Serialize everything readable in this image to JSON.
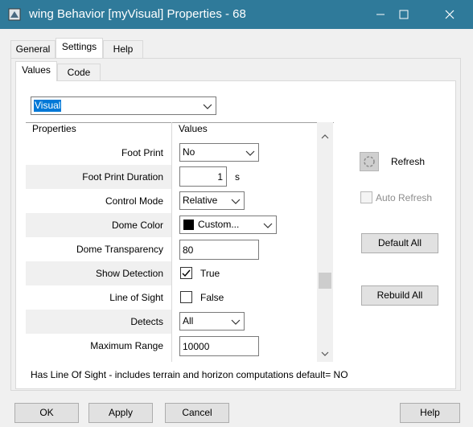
{
  "window": {
    "title": "wing Behavior [myVisual] Properties - 68",
    "controls": {
      "minimize": "minimize",
      "maximize": "maximize",
      "close": "close"
    }
  },
  "main_tabs": [
    {
      "label": "General",
      "active": false
    },
    {
      "label": "Settings",
      "active": true
    },
    {
      "label": "Help",
      "active": false
    }
  ],
  "sub_tabs": [
    {
      "label": "Values",
      "active": true
    },
    {
      "label": "Code",
      "active": false
    }
  ],
  "category_select": {
    "value": "Visual"
  },
  "grid": {
    "headers": {
      "properties": "Properties",
      "values": "Values"
    },
    "rows": [
      {
        "label": "Foot Print",
        "type": "dropdown",
        "value": "No"
      },
      {
        "label": "Foot Print Duration",
        "type": "number",
        "value": "1",
        "unit": "s"
      },
      {
        "label": "Control Mode",
        "type": "dropdown",
        "value": "Relative"
      },
      {
        "label": "Dome Color",
        "type": "color",
        "value": "Custom...",
        "swatch": "#000000"
      },
      {
        "label": "Dome Transparency",
        "type": "text",
        "value": "80"
      },
      {
        "label": "Show Detection",
        "type": "checkbox",
        "checked": true,
        "value": "True"
      },
      {
        "label": "Line of Sight",
        "type": "checkbox",
        "checked": false,
        "value": "False"
      },
      {
        "label": "Detects",
        "type": "dropdown",
        "value": "All"
      },
      {
        "label": "Maximum Range",
        "type": "text",
        "value": "10000"
      }
    ]
  },
  "side_panel": {
    "refresh_label": "Refresh",
    "auto_refresh_label": "Auto Refresh",
    "default_all_label": "Default All",
    "rebuild_all_label": "Rebuild All"
  },
  "status_text": "Has Line Of Sight - includes terrain and horizon computations default= NO",
  "footer": {
    "ok": "OK",
    "apply": "Apply",
    "cancel": "Cancel",
    "help": "Help"
  },
  "colors": {
    "titlebar": "#2f7a9a",
    "selection": "#0078d7"
  }
}
